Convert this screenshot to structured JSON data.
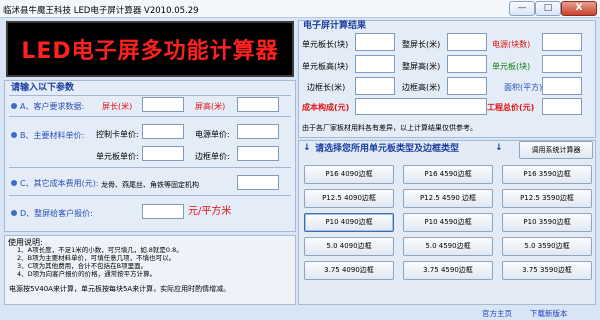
{
  "window": {
    "title": "临沭县牛魔王科技 LED电子屏计算器 V2010.05.29",
    "minimize": "—",
    "maximize": "□",
    "close": "X"
  },
  "banner": {
    "text": "LED电子屏多功能计算器"
  },
  "input_section": {
    "heading": "请输入以下参数",
    "customer_req": {
      "label": "A、客户要求数据:",
      "screen_length": "屏长(米)",
      "screen_height": "屏高(米)"
    },
    "materials": {
      "label": "B、主要材料单价:",
      "control_card": "控制卡单价:",
      "power": "电源单价:",
      "unit_board": "单元板单价:",
      "frame": "边框单价:"
    },
    "other_cost": {
      "label": "C、其它成本费用(元):",
      "note": "龙骨、燕尾丝、角铁等固定机构"
    },
    "quote": {
      "label": "D、整屏给客户报价:",
      "unit": "元/平方米"
    }
  },
  "usage": {
    "heading": "使用说明:",
    "lines": [
      "1、A项长度，不足1米的小数，可只填几，如.8就是0.8。",
      "2、B项为主要材料单价，可填任意几项，不填也可以。",
      "3、C项为其他费用，合计不包括在B项里面。",
      "4、D项为向客户报价的价格，通常按平方计算。"
    ],
    "power_note": "电源按5V40A来计算，单元板按每块5A来计算，实际应用时酌情增减。"
  },
  "results": {
    "heading": "电子屏计算结果",
    "unit_board_length": "单元板长(块)",
    "screen_length": "整屏长(米)",
    "power_count": "电源(块数)",
    "unit_board_height": "单元板高(块)",
    "screen_height": "整屏高(米)",
    "unit_board_count": "单元板(块)",
    "frame_length": "边框长(米)",
    "frame_height": "边框高(米)",
    "area": "面积(平方)",
    "cost": "成本构成(元)",
    "total": "工程总价(元)",
    "note": "由于各厂家板材用料各有差异，以上计算结果仅供参考。"
  },
  "selection": {
    "prompt": "请选择您所用单元板类型及边框类型",
    "arrow_down": "↓",
    "system_calc_button": "调用系统计算器",
    "options": [
      [
        "P16 4090边框",
        "P16 4590边框",
        "P16 3590边框"
      ],
      [
        "P12.5 4090边框",
        "P12.5 4590 边框",
        "P12.5 3590边框"
      ],
      [
        "P10 4090边框",
        "P10 4590边框",
        "P10 3590边框"
      ],
      [
        "5.0 4090边框",
        "5.0 4590边框",
        "5.0 3590边框"
      ],
      [
        "3.75 4090边框",
        "3.75 4590边框",
        "3.75 3590边框"
      ]
    ],
    "selected": "P10 4090边框"
  },
  "footer": {
    "homepage": "官方主页",
    "download": "下载新版本"
  },
  "colors": {
    "accent_blue": "#1b3fa0",
    "red": "#e01010",
    "green": "#108010",
    "banner_bg": "#000000",
    "banner_text": "#ff2020"
  }
}
